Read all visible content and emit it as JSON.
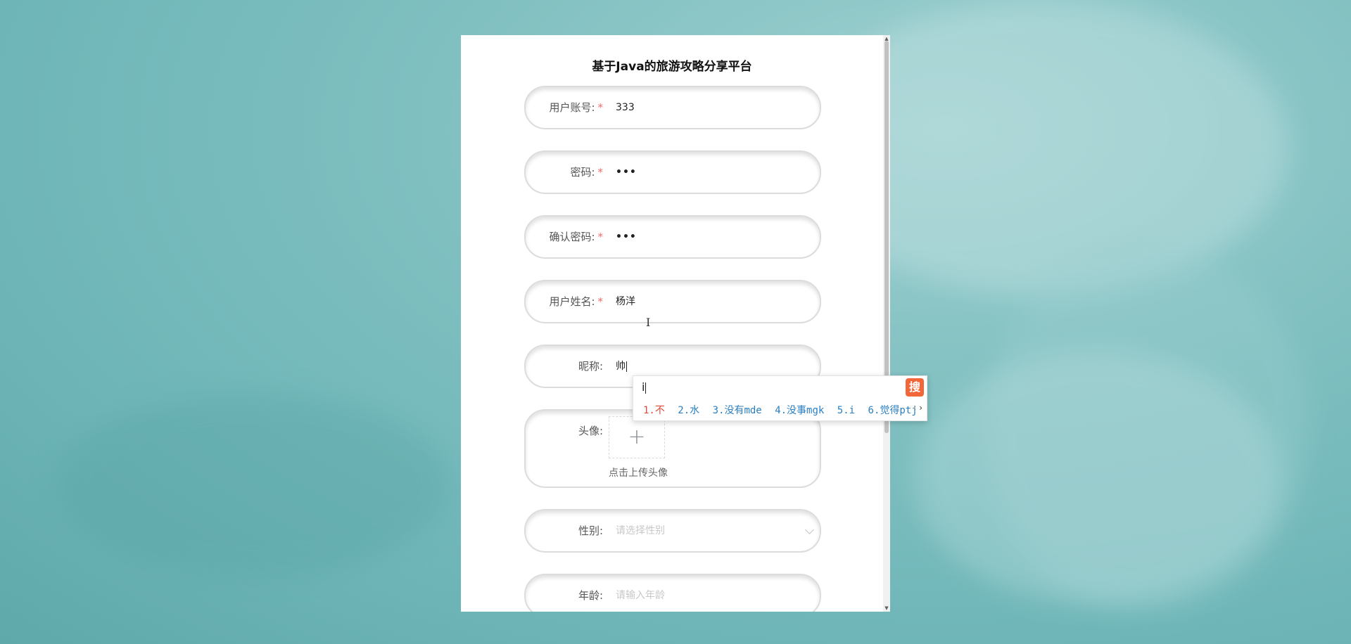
{
  "form": {
    "title": "基于Java的旅游攻略分享平台",
    "fields": {
      "account": {
        "label": "用户账号:",
        "required": "*",
        "value": "333"
      },
      "password": {
        "label": "密码:",
        "required": "*",
        "value": "•••"
      },
      "confirm": {
        "label": "确认密码:",
        "required": "*",
        "value": "•••"
      },
      "realname": {
        "label": "用户姓名:",
        "required": "*",
        "value": "杨洋"
      },
      "nickname": {
        "label": "昵称:",
        "value": "帅"
      },
      "avatar": {
        "label": "头像:",
        "plus": "+",
        "hint": "点击上传头像"
      },
      "gender": {
        "label": "性别:",
        "placeholder": "请选择性别"
      },
      "age": {
        "label": "年龄:",
        "placeholder": "请输入年龄"
      }
    }
  },
  "ime": {
    "input": "i",
    "logo": "搜",
    "candidates": [
      "1.不",
      "2.水",
      "3.没有mde",
      "4.没事mgk",
      "5.i",
      "6.觉得ptj"
    ],
    "prev": "‹",
    "next": "›"
  },
  "scrollbar": {
    "up": "▲",
    "down": "▼"
  },
  "cursor": {
    "ibeam": "I"
  }
}
